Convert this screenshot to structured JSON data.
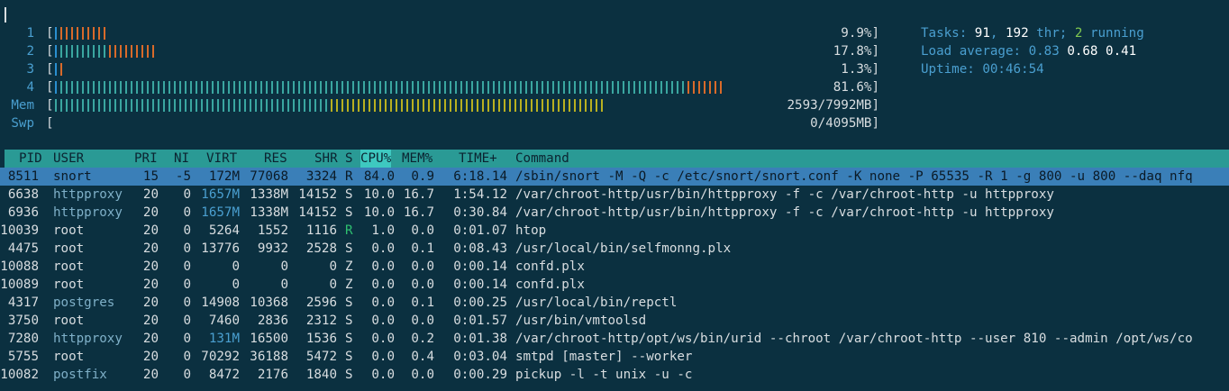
{
  "meters": [
    {
      "label": "1",
      "value": "9.9%]",
      "bars": [
        [
          "b",
          1
        ],
        [
          "o",
          9
        ]
      ]
    },
    {
      "label": "2",
      "value": "17.8%]",
      "bars": [
        [
          "b",
          1
        ],
        [
          "g",
          9
        ],
        [
          "o",
          9
        ]
      ]
    },
    {
      "label": "3",
      "value": "1.3%]",
      "bars": [
        [
          "b",
          1
        ],
        [
          "o",
          1
        ]
      ]
    },
    {
      "label": "4",
      "value": "81.6%]",
      "bars": [
        [
          "b",
          1
        ],
        [
          "g",
          116
        ],
        [
          "o",
          7
        ]
      ]
    },
    {
      "label": "Mem",
      "value": "2593/7992MB]",
      "bars": [
        [
          "g",
          51
        ],
        [
          "y",
          51
        ]
      ]
    },
    {
      "label": "Swp",
      "value": "0/4095MB]",
      "bars": []
    }
  ],
  "info": {
    "tasks_label": "Tasks: ",
    "tasks": "91",
    "thr_sep": ", ",
    "thr": "192",
    "thr_label": " thr; ",
    "running": "2",
    "running_label": " running",
    "load_label": "Load average: ",
    "load1": "0.83",
    "load5": "0.68",
    "load15": "0.41",
    "uptime_label": "Uptime: ",
    "uptime": "00:46:54"
  },
  "columns": [
    "PID",
    "USER",
    "PRI",
    "NI",
    "VIRT",
    "RES",
    "SHR",
    "S",
    "CPU%",
    "MEM%",
    "TIME+",
    "Command"
  ],
  "sort_column": "CPU%",
  "processes": [
    {
      "pid": "8511",
      "user": "snort",
      "pri": "15",
      "ni": "-5",
      "virt": "172M",
      "res": "77068",
      "shr": "3324",
      "s": "R",
      "cpu": "84.0",
      "mem": "0.9",
      "time": "6:18.14",
      "cmd": "/sbin/snort -M -Q -c /etc/snort/snort.conf -K none -P 65535 -R 1 -g 800 -u 800 --daq nfq"
    },
    {
      "pid": "6638",
      "user": "httpproxy",
      "pri": "20",
      "ni": "0",
      "virt": "1657M",
      "res": "1338M",
      "shr": "14152",
      "s": "S",
      "cpu": "10.0",
      "mem": "16.7",
      "time": "1:54.12",
      "cmd": "/var/chroot-http/usr/bin/httpproxy -f -c /var/chroot-http -u httpproxy"
    },
    {
      "pid": "6936",
      "user": "httpproxy",
      "pri": "20",
      "ni": "0",
      "virt": "1657M",
      "res": "1338M",
      "shr": "14152",
      "s": "S",
      "cpu": "10.0",
      "mem": "16.7",
      "time": "0:30.84",
      "cmd": "/var/chroot-http/usr/bin/httpproxy -f -c /var/chroot-http -u httpproxy"
    },
    {
      "pid": "10039",
      "user": "root",
      "pri": "20",
      "ni": "0",
      "virt": "5264",
      "res": "1552",
      "shr": "1116",
      "s": "R",
      "cpu": "1.0",
      "mem": "0.0",
      "time": "0:01.07",
      "cmd": "htop"
    },
    {
      "pid": "4475",
      "user": "root",
      "pri": "20",
      "ni": "0",
      "virt": "13776",
      "res": "9932",
      "shr": "2528",
      "s": "S",
      "cpu": "0.0",
      "mem": "0.1",
      "time": "0:08.43",
      "cmd": "/usr/local/bin/selfmonng.plx"
    },
    {
      "pid": "10088",
      "user": "root",
      "pri": "20",
      "ni": "0",
      "virt": "0",
      "res": "0",
      "shr": "0",
      "s": "Z",
      "cpu": "0.0",
      "mem": "0.0",
      "time": "0:00.14",
      "cmd": "confd.plx"
    },
    {
      "pid": "10089",
      "user": "root",
      "pri": "20",
      "ni": "0",
      "virt": "0",
      "res": "0",
      "shr": "0",
      "s": "Z",
      "cpu": "0.0",
      "mem": "0.0",
      "time": "0:00.14",
      "cmd": "confd.plx"
    },
    {
      "pid": "4317",
      "user": "postgres",
      "pri": "20",
      "ni": "0",
      "virt": "14908",
      "res": "10368",
      "shr": "2596",
      "s": "S",
      "cpu": "0.0",
      "mem": "0.1",
      "time": "0:00.25",
      "cmd": "/usr/local/bin/repctl"
    },
    {
      "pid": "3750",
      "user": "root",
      "pri": "20",
      "ni": "0",
      "virt": "7460",
      "res": "2836",
      "shr": "2312",
      "s": "S",
      "cpu": "0.0",
      "mem": "0.0",
      "time": "0:01.57",
      "cmd": "/usr/bin/vmtoolsd"
    },
    {
      "pid": "7280",
      "user": "httpproxy",
      "pri": "20",
      "ni": "0",
      "virt": "131M",
      "res": "16500",
      "shr": "1536",
      "s": "S",
      "cpu": "0.0",
      "mem": "0.2",
      "time": "0:01.38",
      "cmd": "/var/chroot-http/opt/ws/bin/urid --chroot /var/chroot-http --user 810 --admin /opt/ws/co"
    },
    {
      "pid": "5755",
      "user": "root",
      "pri": "20",
      "ni": "0",
      "virt": "70292",
      "res": "36188",
      "shr": "5472",
      "s": "S",
      "cpu": "0.0",
      "mem": "0.4",
      "time": "0:03.04",
      "cmd": "smtpd [master] --worker"
    },
    {
      "pid": "10082",
      "user": "postfix",
      "pri": "20",
      "ni": "0",
      "virt": "8472",
      "res": "2176",
      "shr": "1840",
      "s": "S",
      "cpu": "0.0",
      "mem": "0.0",
      "time": "0:00.29",
      "cmd": "pickup -l -t unix -u -c"
    }
  ],
  "colors": {
    "background": "#0b3040",
    "header": "#2a9a95",
    "selected": "#3a7fb8",
    "meter_label": "#4a9fd0"
  }
}
